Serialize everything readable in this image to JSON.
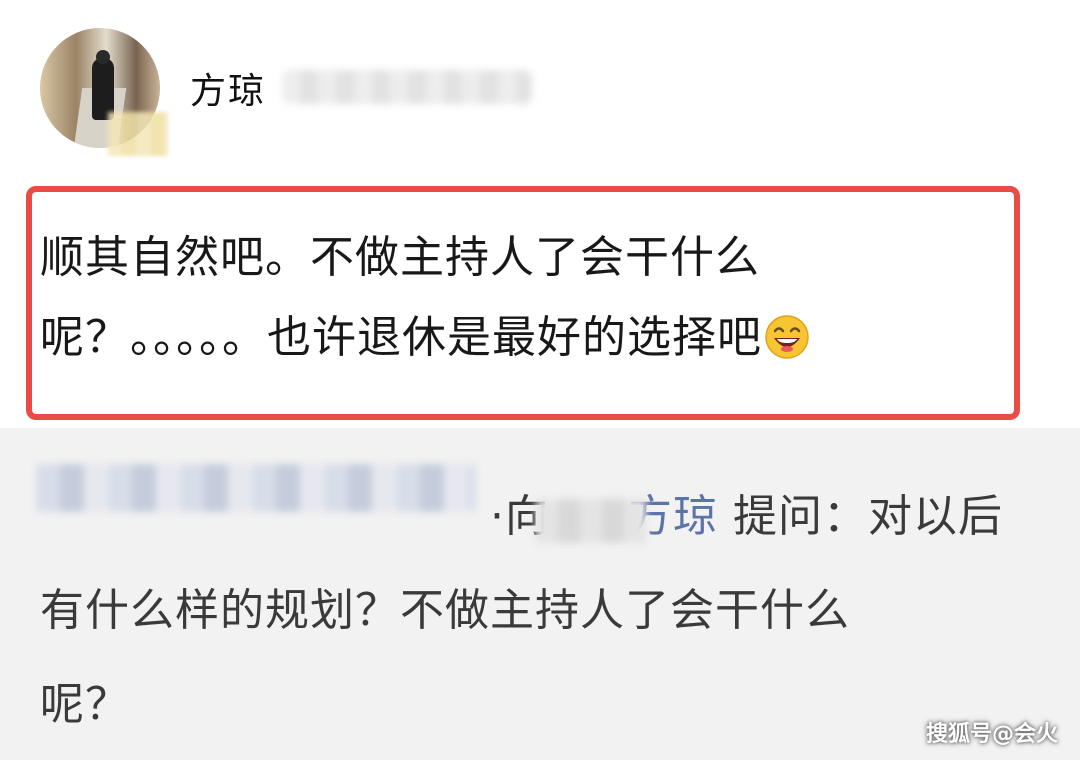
{
  "user": {
    "name": "方琼"
  },
  "post": {
    "line1": "顺其自然吧。不做主持人了会干什么",
    "line2": "呢？。。。。。也许退休是最好的选择吧"
  },
  "answer": {
    "connector": "·向",
    "mention": "方琼",
    "question_line1": " 提问：对以后",
    "question_line2": "有什么样的规划？不做主持人了会干什么",
    "question_line3": "呢？"
  },
  "watermark": "搜狐号@会火",
  "colors": {
    "highlight_border": "#e84c45",
    "mention_link": "#5b73a8",
    "answer_background": "#f2f2f2"
  },
  "icons": {
    "emoji": "laughing-emoji-icon"
  }
}
